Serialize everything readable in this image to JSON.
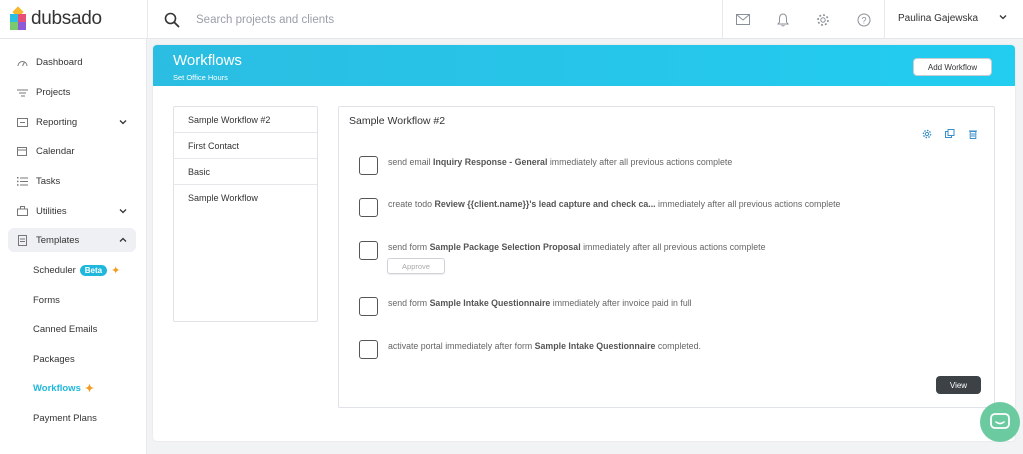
{
  "brand": {
    "name": "dubsado"
  },
  "search": {
    "placeholder": "Search projects and clients"
  },
  "topbar": {
    "icons": [
      "mail-icon",
      "bell-icon",
      "gear-icon",
      "help-icon"
    ],
    "user_name": "Paulina Gajewska"
  },
  "sidebar": {
    "items": [
      {
        "label": "Dashboard",
        "icon": "dashboard-icon"
      },
      {
        "label": "Projects",
        "icon": "projects-icon"
      },
      {
        "label": "Reporting",
        "icon": "reporting-icon"
      },
      {
        "label": "Calendar",
        "icon": "calendar-icon"
      },
      {
        "label": "Tasks",
        "icon": "tasks-icon"
      },
      {
        "label": "Utilities",
        "icon": "utilities-icon"
      },
      {
        "label": "Templates",
        "icon": "templates-icon"
      }
    ],
    "template_subitems": [
      {
        "label": "Scheduler",
        "badge": "Beta"
      },
      {
        "label": "Forms"
      },
      {
        "label": "Canned Emails"
      },
      {
        "label": "Packages"
      },
      {
        "label": "Workflows"
      },
      {
        "label": "Payment Plans"
      }
    ]
  },
  "banner": {
    "title": "Workflows",
    "subtitle": "Set Office Hours",
    "add_button": "Add Workflow"
  },
  "workflow_list": [
    "Sample Workflow #2",
    "First Contact",
    "Basic",
    "Sample Workflow"
  ],
  "detail": {
    "title": "Sample Workflow #2",
    "actions": [
      {
        "pre": "send email ",
        "bold": "Inquiry Response - General",
        "post": " immediately after all previous actions complete"
      },
      {
        "pre": "create todo ",
        "bold": "Review {{client.name}}'s lead capture and check ca...",
        "post": " immediately after all previous actions complete"
      },
      {
        "pre": "send form ",
        "bold": "Sample Package Selection Proposal",
        "post": " immediately after all previous actions complete",
        "button": "Approve"
      },
      {
        "pre": "send form ",
        "bold": "Sample Intake Questionnaire",
        "post": " immediately after invoice paid in full"
      },
      {
        "pre": "activate portal immediately after form ",
        "bold": "Sample Intake Questionnaire",
        "post": " completed."
      }
    ],
    "view_button": "View"
  },
  "colors": {
    "accent": "#1fb8dc",
    "banner": "#22cdf0",
    "chat": "#6ccaa0",
    "sparkle": "#f39c1f"
  }
}
